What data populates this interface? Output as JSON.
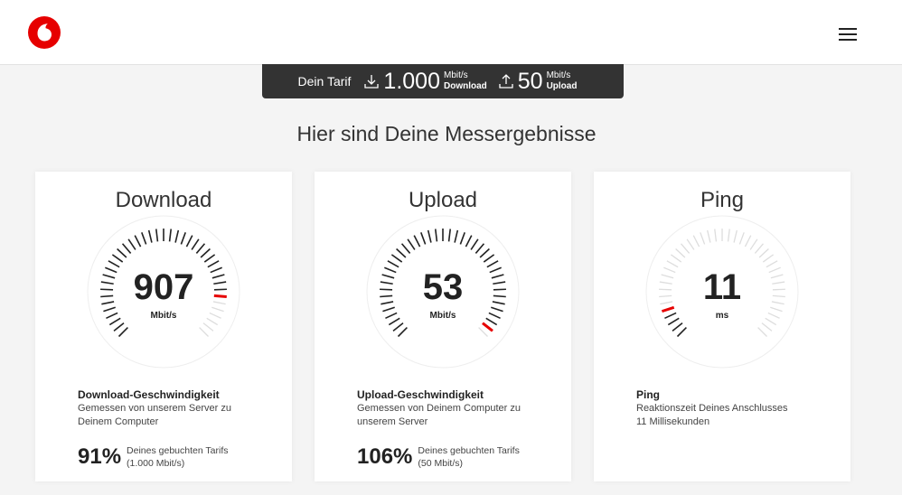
{
  "header": {
    "logo": "vodafone-logo",
    "menu_icon": "hamburger-menu-icon"
  },
  "tariff": {
    "label": "Dein Tarif",
    "download_value": "1.000",
    "download_unit": "Mbit/s",
    "download_label": "Download",
    "upload_value": "50",
    "upload_unit": "Mbit/s",
    "upload_label": "Upload"
  },
  "heading": "Hier sind Deine Messergebnisse",
  "cards": {
    "download": {
      "title": "Download",
      "value": "907",
      "unit": "Mbit/s",
      "desc_title": "Download-Geschwindigkeit",
      "desc_line1": "Gemessen von unserem Server zu",
      "desc_line2": "Deinem Computer",
      "percent": "91%",
      "percent_line1": "Deines gebuchten Tarifs",
      "percent_line2": "(1.000 Mbit/s)",
      "gauge_fraction": 0.84
    },
    "upload": {
      "title": "Upload",
      "value": "53",
      "unit": "Mbit/s",
      "desc_title": "Upload-Geschwindigkeit",
      "desc_line1": "Gemessen von Deinem Computer zu",
      "desc_line2": "unserem Server",
      "percent": "106%",
      "percent_line1": "Deines gebuchten Tarifs",
      "percent_line2": "(50 Mbit/s)",
      "gauge_fraction": 0.98
    },
    "ping": {
      "title": "Ping",
      "value": "11",
      "unit": "ms",
      "desc_title": "Ping",
      "desc_line1": "Reaktionszeit Deines Anschlusses",
      "desc_line2": "11 Millisekunden",
      "gauge_fraction": 0.11
    }
  },
  "colors": {
    "accent": "#e60000",
    "tick": "#222222",
    "tick_inactive": "#dddddd",
    "tariff_bg": "#333333"
  }
}
